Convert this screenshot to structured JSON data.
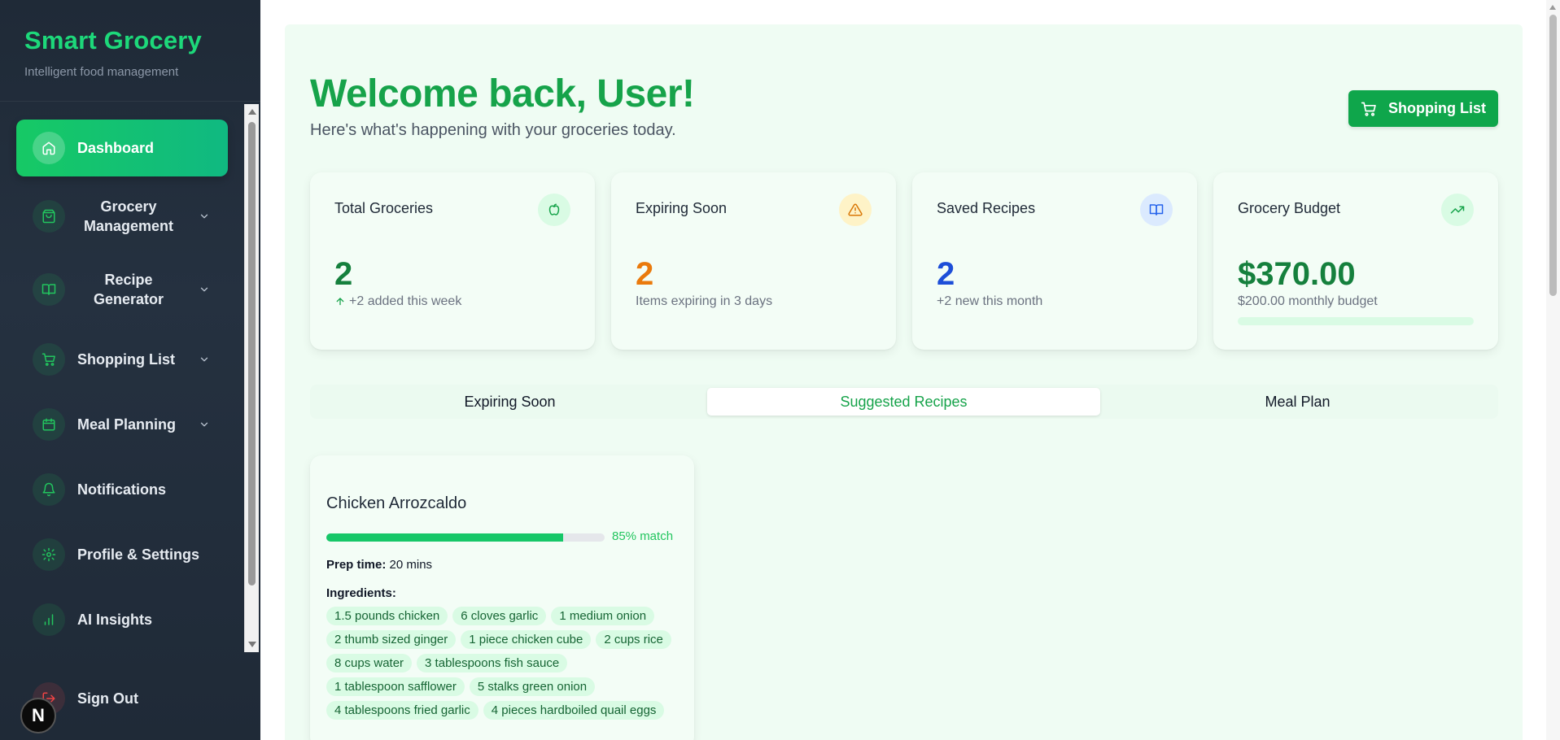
{
  "brand": {
    "title": "Smart Grocery",
    "subtitle": "Intelligent food management"
  },
  "sidebar": {
    "items": [
      {
        "label": "Dashboard",
        "icon": "home-icon",
        "active": true
      },
      {
        "label": "Grocery Management",
        "icon": "shopping-bag-icon"
      },
      {
        "label": "Recipe Generator",
        "icon": "book-open-icon"
      },
      {
        "label": "Shopping List",
        "icon": "cart-icon"
      },
      {
        "label": "Meal Planning",
        "icon": "calendar-icon"
      },
      {
        "label": "Notifications",
        "icon": "bell-icon"
      },
      {
        "label": "Profile & Settings",
        "icon": "gear-icon"
      },
      {
        "label": "AI Insights",
        "icon": "bar-chart-icon"
      }
    ],
    "sign_out": "Sign Out",
    "badge": "N"
  },
  "header": {
    "title": "Welcome back, User!",
    "subtitle": "Here's what's happening with your groceries today.",
    "shopping_button": "Shopping List"
  },
  "stats": [
    {
      "title": "Total Groceries",
      "value": "2",
      "note": "+2 added this week",
      "color": "#15803d",
      "icon": "apple-icon"
    },
    {
      "title": "Expiring Soon",
      "value": "2",
      "note": "Items expiring in 3 days",
      "color": "#ea7a0c",
      "icon": "warning-icon"
    },
    {
      "title": "Saved Recipes",
      "value": "2",
      "note": "+2 new this month",
      "color": "#1d4ed8",
      "icon": "book-icon"
    },
    {
      "title": "Grocery Budget",
      "value": "$370.00",
      "note": "$200.00 monthly budget",
      "color": "#15803d",
      "icon": "trending-up-icon",
      "budget_progress": 0
    }
  ],
  "tabs": [
    {
      "label": "Expiring Soon"
    },
    {
      "label": "Suggested Recipes",
      "active": true
    },
    {
      "label": "Meal Plan"
    }
  ],
  "recipe": {
    "name": "Chicken Arrozcaldo",
    "match_percent": 85,
    "match_label": "85% match",
    "prep_label": "Prep time:",
    "prep_value": "20 mins",
    "ingredients_label": "Ingredients:",
    "ingredients": [
      "1.5 pounds chicken",
      "6 cloves garlic",
      "1 medium onion",
      "2 thumb sized ginger",
      "1 piece chicken cube",
      "2 cups rice",
      "8 cups water",
      "3 tablespoons fish sauce",
      "1 tablespoon safflower",
      "5 stalks green onion",
      "4 tablespoons fried garlic",
      "4 pieces hardboiled quail eggs"
    ]
  },
  "colors": {
    "accent": "#16a34a",
    "sidebar_bg": "#1f2a37",
    "panel_bg": "#effcf3"
  }
}
